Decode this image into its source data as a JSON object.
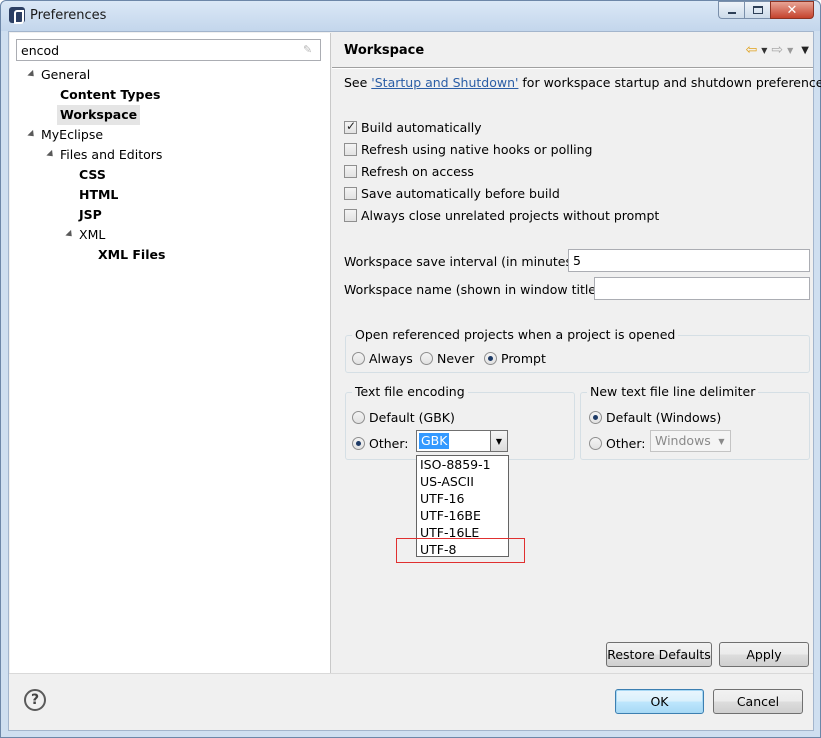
{
  "window": {
    "title": "Preferences"
  },
  "filter": {
    "value": "encod"
  },
  "tree": {
    "general": "General",
    "content_types": "Content Types",
    "workspace": "Workspace",
    "myeclipse": "MyEclipse",
    "files_editors": "Files and Editors",
    "css": "CSS",
    "html": "HTML",
    "jsp": "JSP",
    "xml": "XML",
    "xml_files": "XML Files"
  },
  "page": {
    "title": "Workspace",
    "desc_prefix": "See ",
    "desc_link": "'Startup and Shutdown'",
    "desc_suffix": " for workspace startup and shutdown preferences.",
    "checkboxes": [
      {
        "label": "Build automatically",
        "checked": true
      },
      {
        "label": "Refresh using native hooks or polling",
        "checked": false
      },
      {
        "label": "Refresh on access",
        "checked": false
      },
      {
        "label": "Save automatically before build",
        "checked": false
      },
      {
        "label": "Always close unrelated projects without prompt",
        "checked": false
      }
    ],
    "save_interval_label": "Workspace save interval (in minutes):",
    "save_interval_value": "5",
    "workspace_name_label": "Workspace name (shown in window title):",
    "workspace_name_value": "",
    "open_group": {
      "label": "Open referenced projects when a project is opened",
      "options": [
        "Always",
        "Never",
        "Prompt"
      ],
      "selected": "Prompt"
    },
    "encoding_group": {
      "label": "Text file encoding",
      "default_label": "Default (GBK)",
      "other_label": "Other:",
      "other_value": "GBK",
      "selected": "Other"
    },
    "encoding_options": [
      "ISO-8859-1",
      "US-ASCII",
      "UTF-16",
      "UTF-16BE",
      "UTF-16LE",
      "UTF-8"
    ],
    "delimiter_group": {
      "label": "New text file line delimiter",
      "default_label": "Default (Windows)",
      "other_label": "Other:",
      "other_value": "Windows",
      "selected": "Default"
    },
    "restore_defaults": "Restore Defaults",
    "apply": "Apply"
  },
  "footer": {
    "ok": "OK",
    "cancel": "Cancel",
    "help": "?"
  },
  "colors": {
    "link": "#2b5ea6",
    "highlight": "#3399ff",
    "annotation": "#e03030"
  }
}
